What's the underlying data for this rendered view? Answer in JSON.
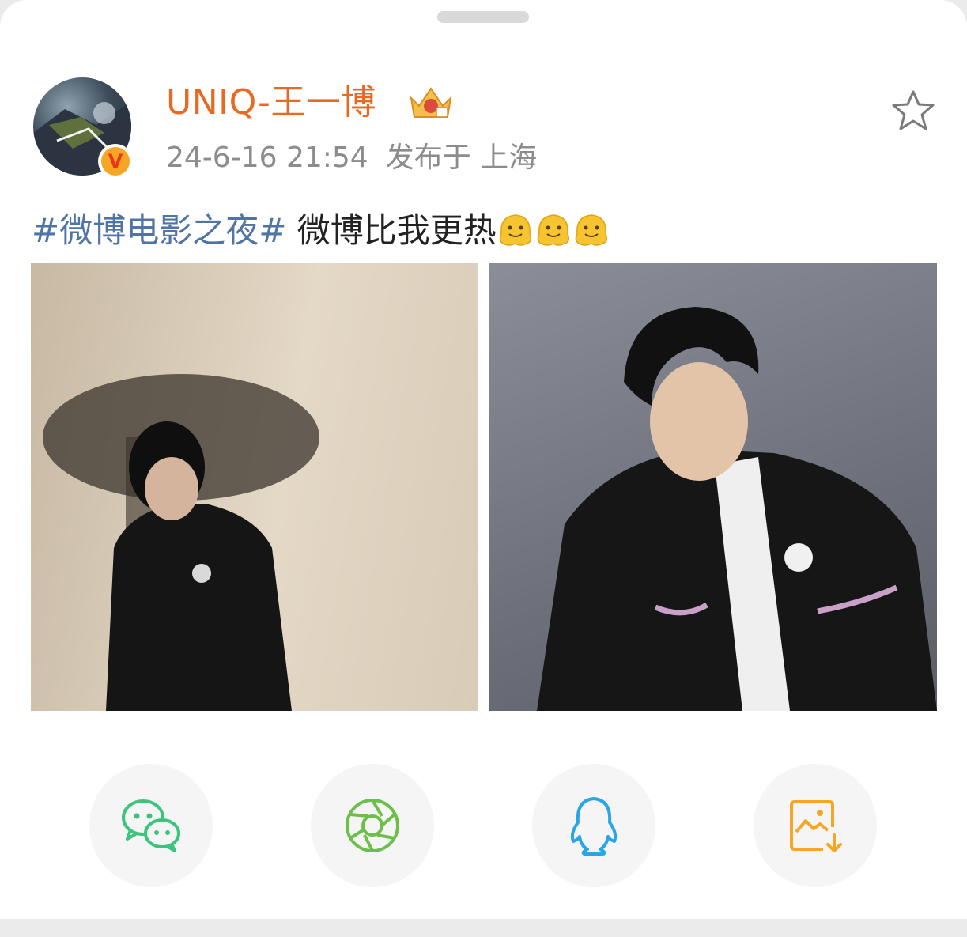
{
  "post": {
    "username": "UNIQ-王一博",
    "time": "24-6-16 21:54",
    "location": "发布于 上海",
    "topic": "#微博电影之夜#",
    "text": " 微博比我更热",
    "emoji_name": "melting-face-emoji",
    "verified_badge": "V"
  },
  "share_options": [
    {
      "icon": "wechat-icon",
      "color": "#3cc47c"
    },
    {
      "icon": "moments-shutter-icon",
      "color": "#6cc04a"
    },
    {
      "icon": "qq-penguin-icon",
      "color": "#2aa5e8"
    },
    {
      "icon": "save-image-icon",
      "color": "#f5a623"
    }
  ],
  "colors": {
    "username": "#e86a22",
    "topic": "#4f74a5",
    "meta": "#8c8c8c"
  }
}
